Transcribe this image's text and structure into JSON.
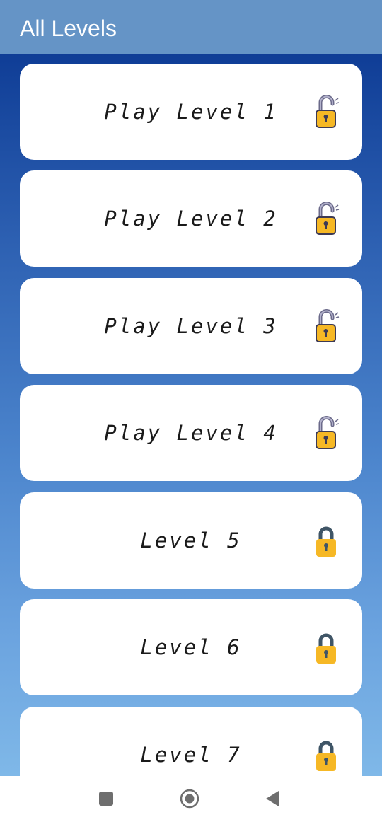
{
  "app_bar": {
    "title": "All Levels"
  },
  "levels": [
    {
      "label": "Play Level 1",
      "lock": "unlocked"
    },
    {
      "label": "Play Level 2",
      "lock": "unlocked"
    },
    {
      "label": "Play Level 3",
      "lock": "unlocked"
    },
    {
      "label": "Play Level 4",
      "lock": "unlocked"
    },
    {
      "label": "Level 5",
      "lock": "locked"
    },
    {
      "label": "Level 6",
      "lock": "locked"
    },
    {
      "label": "Level 7",
      "lock": "locked"
    }
  ],
  "colors": {
    "app_bar": "#6594c6",
    "gradient_top": "#0f3d96",
    "gradient_bottom": "#7fb8e8",
    "lock_gold": "#f6b825",
    "lock_shackle": "#3f5566",
    "open_shackle": "#6b6a8a"
  },
  "nav": {
    "icons": [
      "recents-square-icon",
      "home-circle-icon",
      "back-triangle-icon"
    ]
  }
}
